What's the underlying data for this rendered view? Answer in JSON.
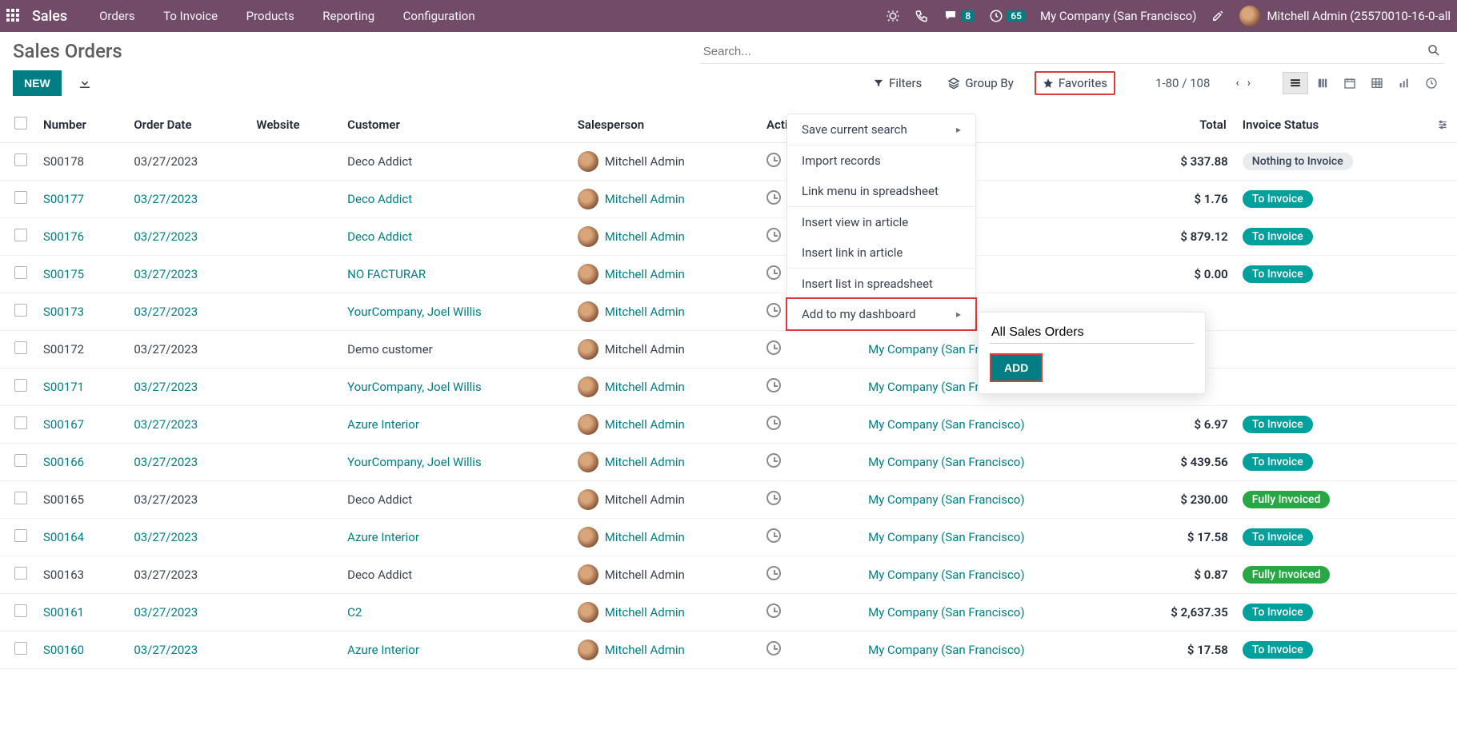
{
  "topbar": {
    "brand": "Sales",
    "menu": [
      "Orders",
      "To Invoice",
      "Products",
      "Reporting",
      "Configuration"
    ],
    "msg_badge": "8",
    "activity_badge": "65",
    "company": "My Company (San Francisco)",
    "user": "Mitchell Admin (25570010-16-0-all"
  },
  "page": {
    "title": "Sales Orders",
    "search_placeholder": "Search...",
    "new_btn": "NEW",
    "filters": "Filters",
    "groupby": "Group By",
    "favorites": "Favorites",
    "pager": "1-80 / 108"
  },
  "fav_menu": {
    "save": "Save current search",
    "import": "Import records",
    "link_menu": "Link menu in spreadsheet",
    "insert_view": "Insert view in article",
    "insert_link": "Insert link in article",
    "insert_list": "Insert list in spreadsheet",
    "add_dash": "Add to my dashboard"
  },
  "sub_popup": {
    "input_value": "All Sales Orders",
    "add_btn": "ADD"
  },
  "columns": {
    "number": "Number",
    "order_date": "Order Date",
    "website": "Website",
    "customer": "Customer",
    "salesperson": "Salesperson",
    "activities": "Activities",
    "company": "",
    "total": "Total",
    "invoice_status": "Invoice Status"
  },
  "rows": [
    {
      "num": "S00178",
      "date": "03/27/2023",
      "customer": "Deco Addict",
      "sp": "Mitchell Admin",
      "company": "",
      "total": "$ 337.88",
      "status": "Nothing to Invoice",
      "stype": "nothing",
      "link": false
    },
    {
      "num": "S00177",
      "date": "03/27/2023",
      "customer": "Deco Addict",
      "sp": "Mitchell Admin",
      "company": "",
      "total": "$ 1.76",
      "status": "To Invoice",
      "stype": "toinvoice",
      "link": true
    },
    {
      "num": "S00176",
      "date": "03/27/2023",
      "customer": "Deco Addict",
      "sp": "Mitchell Admin",
      "company": "",
      "total": "$ 879.12",
      "status": "To Invoice",
      "stype": "toinvoice",
      "link": true
    },
    {
      "num": "S00175",
      "date": "03/27/2023",
      "customer": "NO FACTURAR",
      "sp": "Mitchell Admin",
      "company": "",
      "total": "$ 0.00",
      "status": "To Invoice",
      "stype": "toinvoice",
      "link": true
    },
    {
      "num": "S00173",
      "date": "03/27/2023",
      "customer": "YourCompany, Joel Willis",
      "sp": "Mitchell Admin",
      "company": "",
      "total": "",
      "status": "",
      "stype": "",
      "link": true
    },
    {
      "num": "S00172",
      "date": "03/27/2023",
      "customer": "Demo customer",
      "sp": "Mitchell Admin",
      "company": "My Company (San Francisco)",
      "total": "",
      "status": "",
      "stype": "",
      "link": false
    },
    {
      "num": "S00171",
      "date": "03/27/2023",
      "customer": "YourCompany, Joel Willis",
      "sp": "Mitchell Admin",
      "company": "My Company (San Francisco)",
      "total": "",
      "status": "",
      "stype": "",
      "link": true
    },
    {
      "num": "S00167",
      "date": "03/27/2023",
      "customer": "Azure Interior",
      "sp": "Mitchell Admin",
      "company": "My Company (San Francisco)",
      "total": "$ 6.97",
      "status": "To Invoice",
      "stype": "toinvoice",
      "link": true
    },
    {
      "num": "S00166",
      "date": "03/27/2023",
      "customer": "YourCompany, Joel Willis",
      "sp": "Mitchell Admin",
      "company": "My Company (San Francisco)",
      "total": "$ 439.56",
      "status": "To Invoice",
      "stype": "toinvoice",
      "link": true
    },
    {
      "num": "S00165",
      "date": "03/27/2023",
      "customer": "Deco Addict",
      "sp": "Mitchell Admin",
      "company": "My Company (San Francisco)",
      "total": "$ 230.00",
      "status": "Fully Invoiced",
      "stype": "fully",
      "link": false
    },
    {
      "num": "S00164",
      "date": "03/27/2023",
      "customer": "Azure Interior",
      "sp": "Mitchell Admin",
      "company": "My Company (San Francisco)",
      "total": "$ 17.58",
      "status": "To Invoice",
      "stype": "toinvoice",
      "link": true
    },
    {
      "num": "S00163",
      "date": "03/27/2023",
      "customer": "Deco Addict",
      "sp": "Mitchell Admin",
      "company": "My Company (San Francisco)",
      "total": "$ 0.87",
      "status": "Fully Invoiced",
      "stype": "fully",
      "link": false
    },
    {
      "num": "S00161",
      "date": "03/27/2023",
      "customer": "C2",
      "sp": "Mitchell Admin",
      "company": "My Company (San Francisco)",
      "total": "$ 2,637.35",
      "status": "To Invoice",
      "stype": "toinvoice",
      "link": true
    },
    {
      "num": "S00160",
      "date": "03/27/2023",
      "customer": "Azure Interior",
      "sp": "Mitchell Admin",
      "company": "My Company (San Francisco)",
      "total": "$ 17.58",
      "status": "To Invoice",
      "stype": "toinvoice",
      "link": true
    }
  ]
}
